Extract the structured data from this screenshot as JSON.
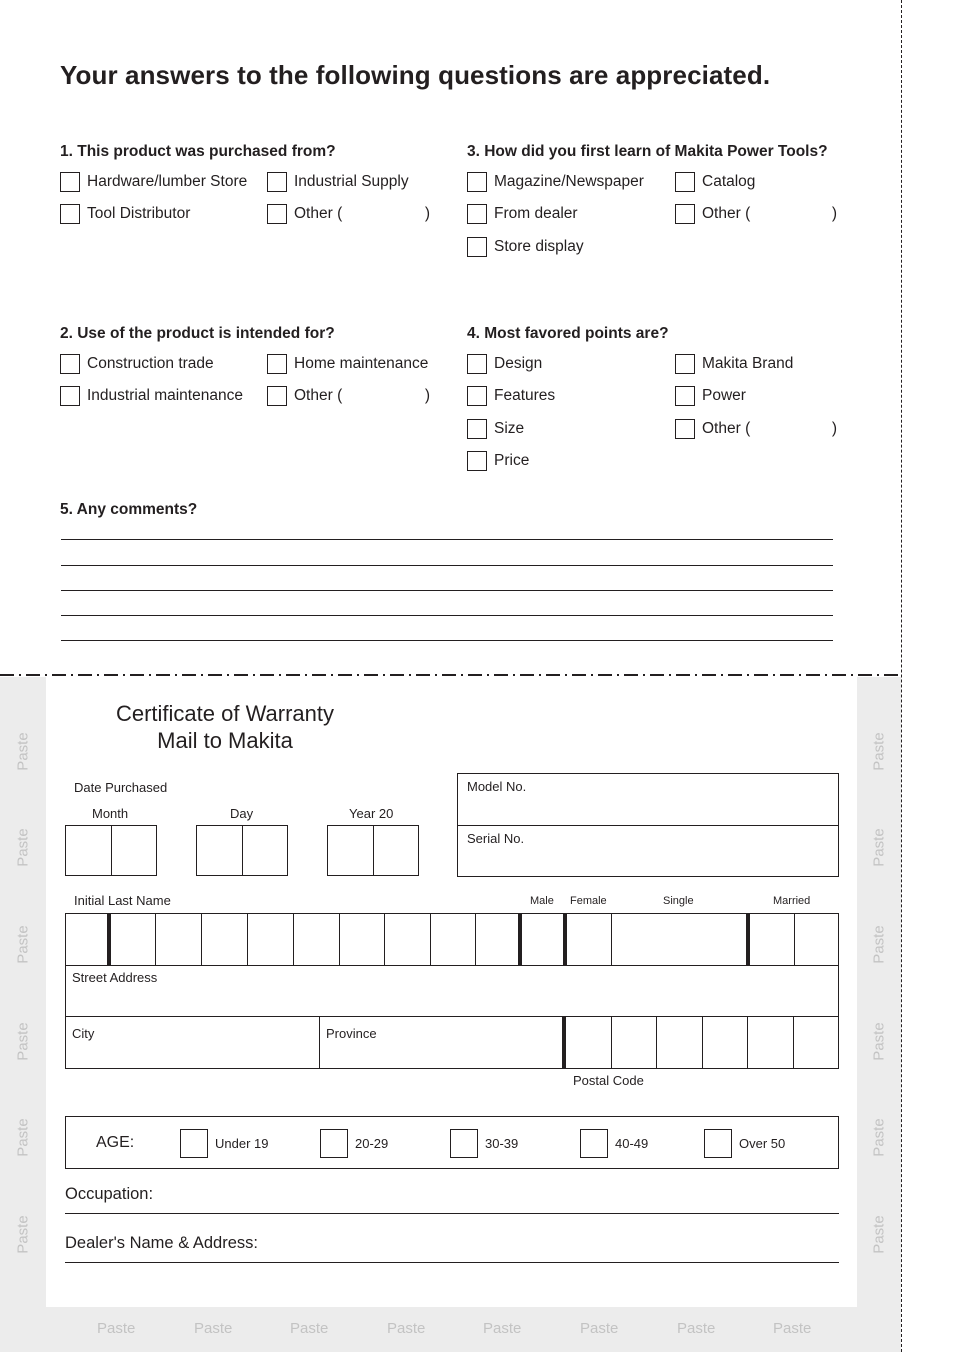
{
  "page_title": "Your answers to the following questions are appreciated.",
  "questions": [
    {
      "title": "1. This product was purchased from?",
      "options": [
        "Hardware/lumber Store",
        "Industrial Supply",
        "Tool Distributor",
        "Other ("
      ]
    },
    {
      "title": "2. Use of the product is intended for?",
      "options": [
        "Construction trade",
        "Home maintenance",
        "Industrial maintenance",
        "Other ("
      ]
    },
    {
      "title": "3. How did you first learn of Makita Power Tools?",
      "options": [
        "Magazine/Newspaper",
        "Catalog",
        "From dealer",
        "Other (",
        "Store display"
      ]
    },
    {
      "title": "4. Most favored points are?",
      "options": [
        "Design",
        "Makita Brand",
        "Features",
        "Power",
        "Size",
        "Other (",
        "Price"
      ]
    },
    {
      "title": "5. Any comments?",
      "lines": 5
    }
  ],
  "other_close": ")",
  "paste_label": "Paste",
  "certificate": {
    "title_line1": "Certificate of Warranty",
    "title_line2": "Mail to Makita",
    "date_purchased": "Date Purchased",
    "month": "Month",
    "day": "Day",
    "year": "Year 20",
    "model_no": "Model No.",
    "serial_no": "Serial No.",
    "initial_last_name": "Initial Last Name",
    "male": "Male",
    "female": "Female",
    "single": "Single",
    "married": "Married",
    "street_address": "Street Address",
    "city": "City",
    "province": "Province",
    "postal_code": "Postal Code",
    "age_label": "AGE:",
    "age_options": [
      "Under 19",
      "20-29",
      "30-39",
      "40-49",
      "Over 50"
    ],
    "occupation": "Occupation:",
    "dealer": "Dealer's Name & Address:"
  }
}
